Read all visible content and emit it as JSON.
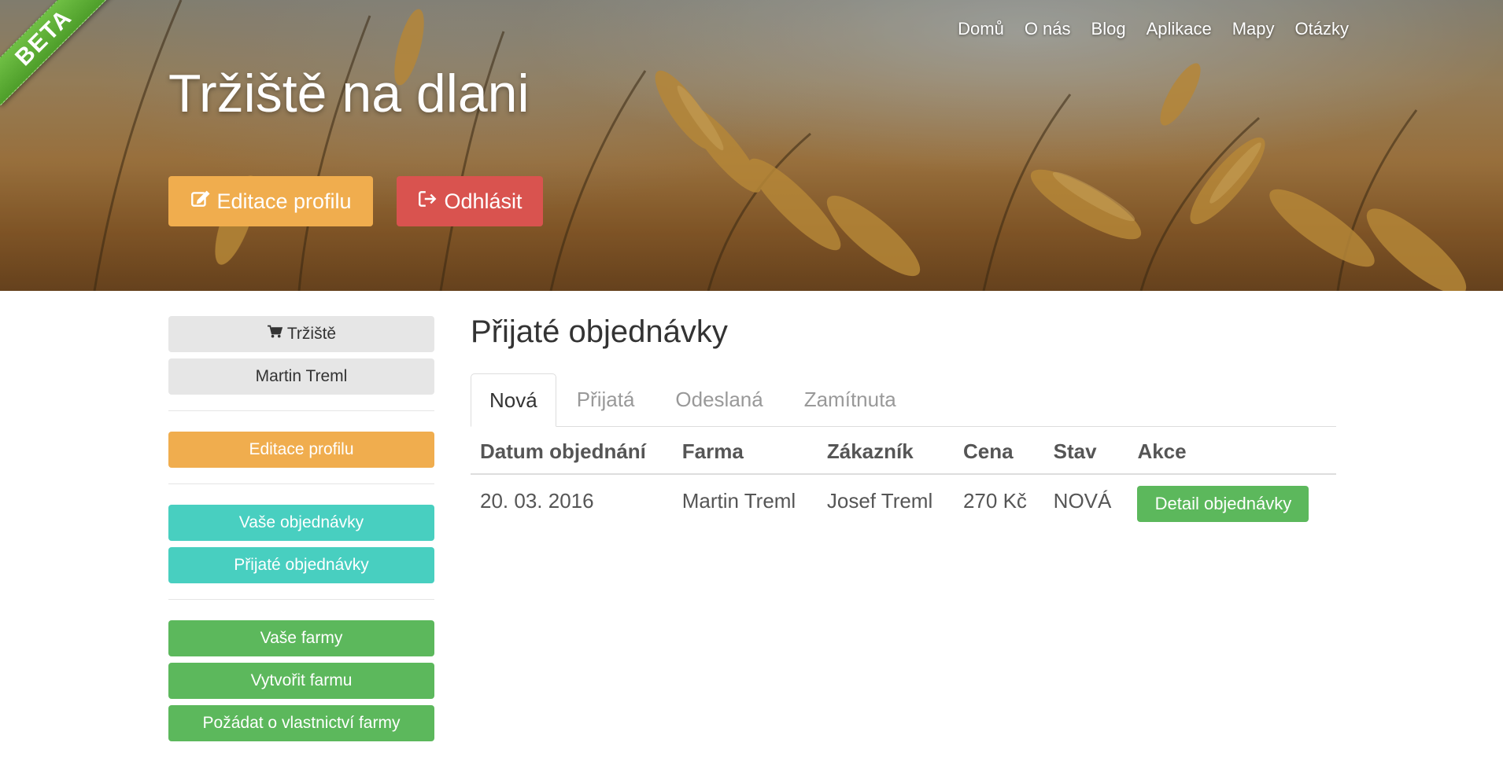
{
  "hero": {
    "ribbon": "BETA",
    "title": "Tržiště na dlani",
    "nav": [
      "Domů",
      "O nás",
      "Blog",
      "Aplikace",
      "Mapy",
      "Otázky"
    ],
    "edit_profile_label": "Editace profilu",
    "logout_label": "Odhlásit"
  },
  "sidebar": {
    "market_label": "Tržiště",
    "user_name": "Martin Treml",
    "edit_profile_label": "Editace profilu",
    "your_orders_label": "Vaše objednávky",
    "received_orders_label": "Přijaté objednávky",
    "your_farms_label": "Vaše farmy",
    "create_farm_label": "Vytvořit farmu",
    "request_ownership_label": "Požádat o vlastnictví farmy"
  },
  "main": {
    "title": "Přijaté objednávky",
    "tabs": [
      "Nová",
      "Přijatá",
      "Odeslaná",
      "Zamítnuta"
    ],
    "active_tab": "Nová",
    "columns": [
      "Datum objednání",
      "Farma",
      "Zákazník",
      "Cena",
      "Stav",
      "Akce"
    ],
    "rows": [
      {
        "date": "20. 03. 2016",
        "farm": "Martin Treml",
        "customer": "Josef Treml",
        "price": "270 Kč",
        "status": "NOVÁ",
        "action_label": "Detail objednávky"
      }
    ]
  },
  "colors": {
    "warning": "#f0ad4e",
    "danger": "#d9534f",
    "teal": "#48cfc0",
    "success": "#5cb85c",
    "ribbon": "#5aab33"
  },
  "icons": {
    "market": "cart-icon",
    "edit": "edit-icon",
    "logout": "logout-icon"
  }
}
